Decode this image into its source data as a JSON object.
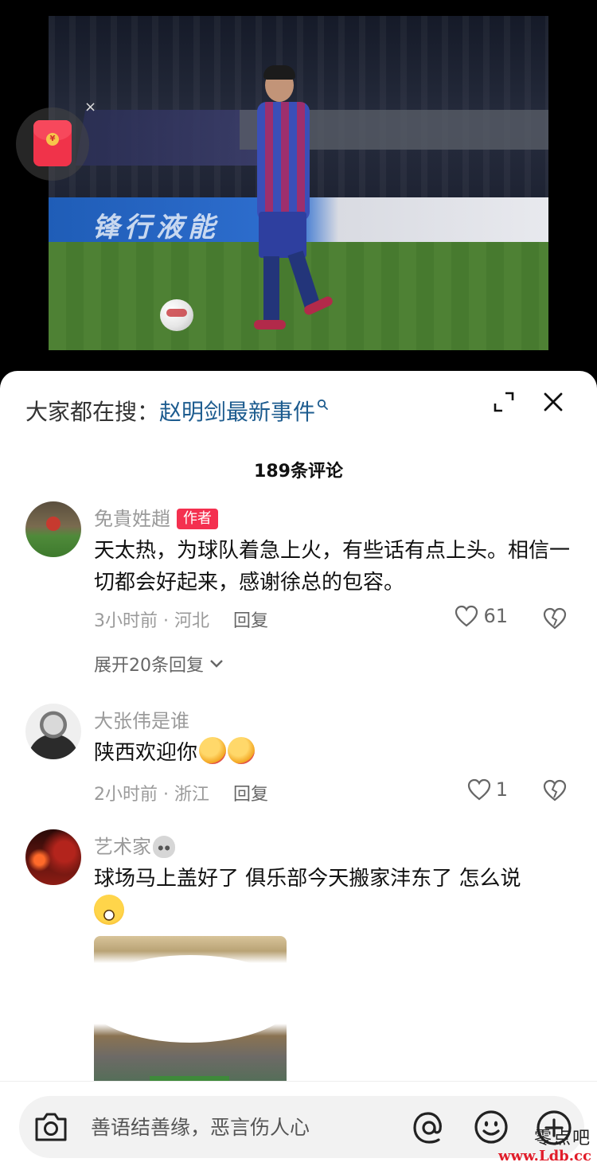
{
  "colors": {
    "accent_link": "#1d5c8f",
    "author_badge": "#f4304f",
    "hongbao": "#f0334a",
    "sheet_bg": "#ffffff",
    "media_bg": "#000000"
  },
  "media": {
    "board_text": "锋行液能",
    "hongbao": {
      "icon": "red-envelope-icon",
      "coin_symbol": "¥",
      "close_symbol": "×"
    }
  },
  "header": {
    "search_label": "大家都在搜：",
    "search_link": "赵明剑最新事件",
    "expand_icon": "expand-icon",
    "close_icon": "close-icon"
  },
  "comment_count": "189条评论",
  "comments": [
    {
      "username": "免貴姓趙",
      "badge": "作者",
      "text": "天太热，为球队着急上火，有些话有点上头。相信一切都会好起来，感谢徐总的包容。",
      "time": "3小时前",
      "location": "河北",
      "reply_label": "回复",
      "likes": "61",
      "expand_replies": "展开20条回复"
    },
    {
      "username": "大张伟是谁",
      "text": "陕西欢迎你",
      "emojis": [
        "thumbs-up",
        "thumbs-up"
      ],
      "time": "2小时前",
      "location": "浙江",
      "reply_label": "回复",
      "likes": "1"
    },
    {
      "username": "艺术家",
      "username_emoji": "alien",
      "text": "球场马上盖好了 俱乐部今天搬家沣东了 怎么说",
      "text_emoji": "grinning",
      "image": "stadium-photo"
    }
  ],
  "meta_separator": " · ",
  "input": {
    "placeholder": "善语结善缘，恶言伤人心",
    "icons": [
      "camera-icon",
      "at-icon",
      "emoji-icon",
      "plus-icon"
    ]
  },
  "watermark": {
    "cn": "零点吧",
    "url": "www.Ldb.cc"
  }
}
